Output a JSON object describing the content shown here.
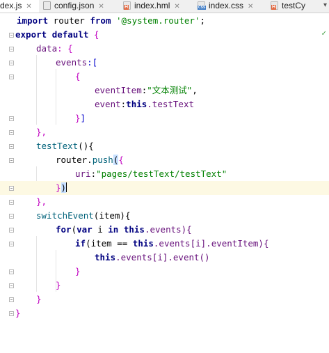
{
  "tabs": [
    {
      "label": "dex.js",
      "icon": "file-icon"
    },
    {
      "label": "config.json",
      "icon": "json-file-icon"
    },
    {
      "label": "index.hml",
      "icon": "html-file-icon"
    },
    {
      "label": "index.css",
      "icon": "css-file-icon"
    },
    {
      "label": "testCy",
      "icon": "html-file-icon"
    }
  ],
  "tab_menu": "▾",
  "check": "✓",
  "code": {
    "l1_import": "import",
    "l1_router": " router ",
    "l1_from": "from",
    "l1_sp": " ",
    "l1_str": "'@system.router'",
    "l1_end": ";",
    "l2_export": "export",
    "l2_sp": " ",
    "l2_default": "default",
    "l2_brace": " {",
    "l3_key": "data",
    "l3_rest": ": {",
    "l4_key": "events",
    "l4_rest": ":[",
    "l5": "{",
    "l6_key": "eventItem",
    "l6_colon": ":",
    "l6_str": "\"文本测试\"",
    "l6_end": ",",
    "l7_key": "event",
    "l7_colon": ":",
    "l7_this": "this",
    "l7_rest": ".testText",
    "l8_brace": "}",
    "l8_bracket": "]",
    "l9": "},",
    "l10_fn": "testText",
    "l10_rest": "(){",
    "l11_obj": "router.",
    "l11_fn": "push",
    "l11_paren": "(",
    "l11_brace": "{",
    "l12_key": "uri",
    "l12_colon": ":",
    "l12_str": "\"pages/testText/testText\"",
    "l13_brace": "}",
    "l13_paren": ")",
    "l14": "},",
    "l15_fn": "switchEvent",
    "l15_rest": "(item){",
    "l16_for": "for",
    "l16_a": "(",
    "l16_var": "var",
    "l16_b": " i ",
    "l16_in": "in",
    "l16_c": " ",
    "l16_this": "this",
    "l16_d": ".events){",
    "l17_if": "if",
    "l17_a": "(item == ",
    "l17_this": "this",
    "l17_b": ".events[i].eventItem){",
    "l18_this": "this",
    "l18_rest": ".events[i].event()",
    "l19": "}",
    "l20": "}",
    "l21": "}",
    "l22": "}"
  }
}
